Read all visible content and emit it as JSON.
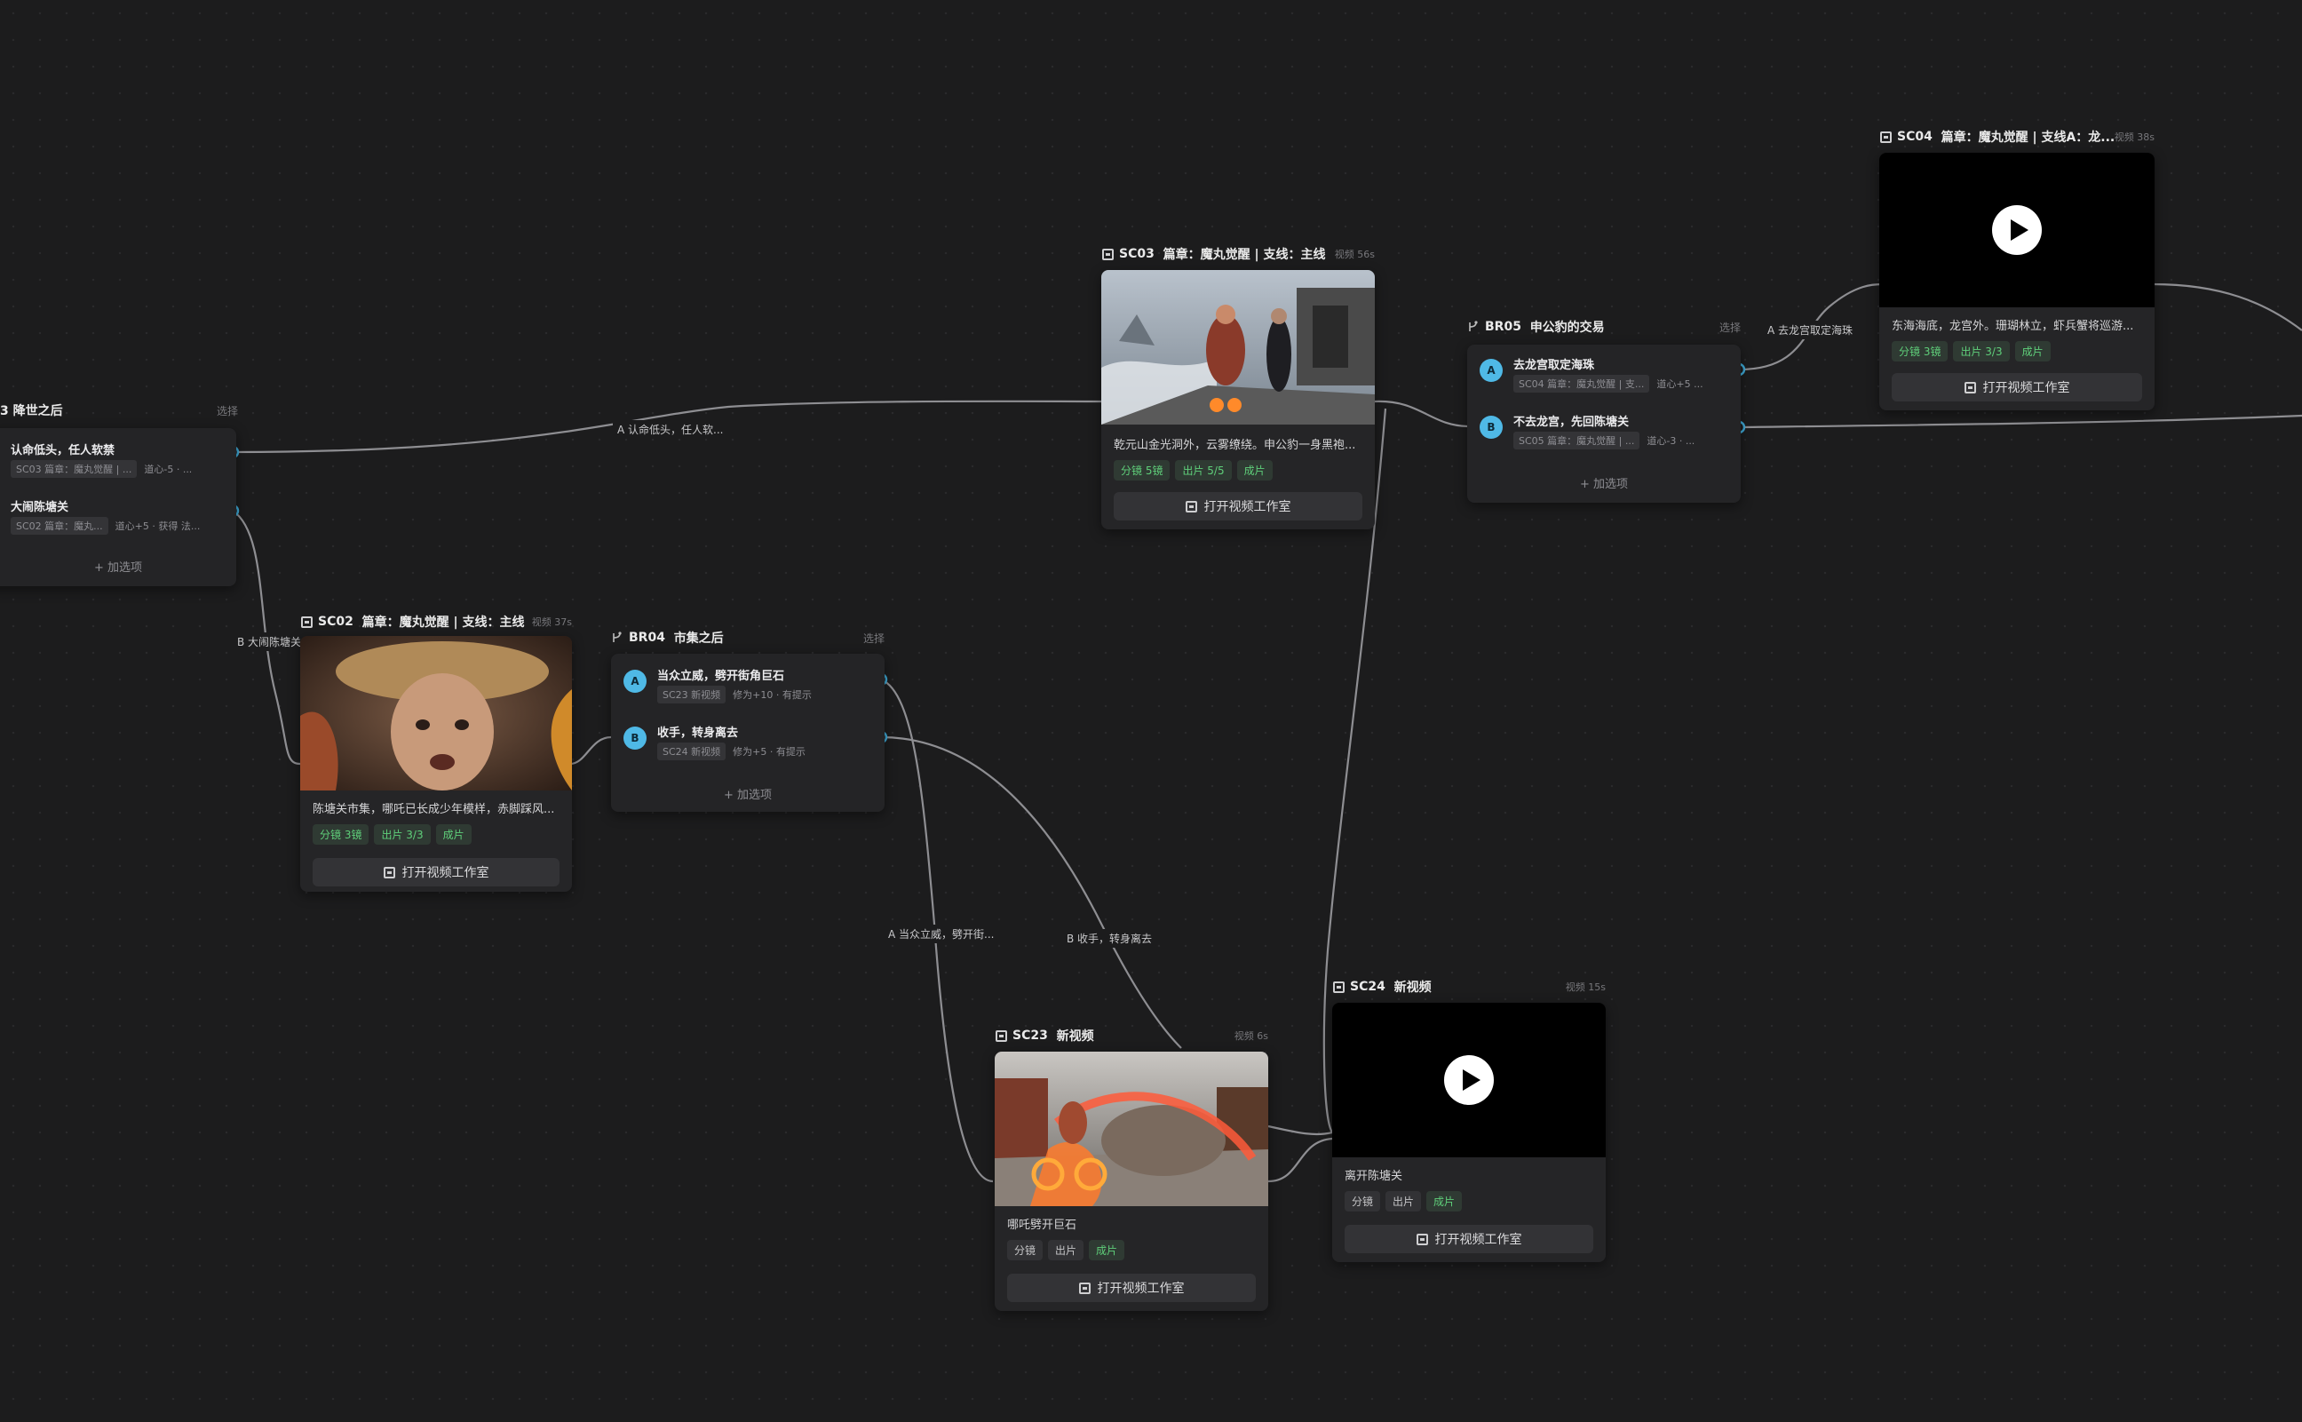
{
  "edge_labels": {
    "a_rengming": "A 认命低头，任人软...",
    "b_danao": "B 大闹陈塘关",
    "a_dangzhong": "A 当众立威，劈开街...",
    "b_shoushou": "B 收手，转身离去",
    "a_qu_longgong": "A 去龙宫取定海珠"
  },
  "br03": {
    "title": "3  降世之后",
    "select": "选择",
    "options": [
      {
        "title": "认命低头，任人软禁",
        "chip": "SC03 篇章：魔丸觉醒 | ...",
        "effect": "道心-5 · ..."
      },
      {
        "title": "大闹陈塘关",
        "chip": "SC02 篇章：魔丸...",
        "effect": "道心+5 · 获得 法..."
      }
    ],
    "add": "+ 加选项"
  },
  "br04": {
    "id": "BR04",
    "title": "市集之后",
    "select": "选择",
    "options": [
      {
        "letter": "A",
        "title": "当众立威，劈开街角巨石",
        "chip": "SC23 新视频",
        "effect": "修为+10 · 有提示"
      },
      {
        "letter": "B",
        "title": "收手，转身离去",
        "chip": "SC24 新视频",
        "effect": "修为+5 · 有提示"
      }
    ],
    "add": "+ 加选项"
  },
  "br05": {
    "id": "BR05",
    "title": "申公豹的交易",
    "select": "选择",
    "options": [
      {
        "letter": "A",
        "title": "去龙宫取定海珠",
        "chip": "SC04 篇章：魔丸觉醒 | 支...",
        "effect": "道心+5 ..."
      },
      {
        "letter": "B",
        "title": "不去龙宫，先回陈塘关",
        "chip": "SC05 篇章：魔丸觉醒 | ...",
        "effect": "道心-3 · ..."
      }
    ],
    "add": "+ 加选项"
  },
  "sc02": {
    "id": "SC02",
    "title": "篇章：魔丸觉醒 | 支线：主线",
    "meta": "视频 37s",
    "desc": "陈塘关市集，哪吒已长成少年模样，赤脚踩风...",
    "tags": [
      "分镜  3镜",
      "出片  3/3",
      "成片"
    ],
    "button": "打开视频工作室"
  },
  "sc03": {
    "id": "SC03",
    "title": "篇章：魔丸觉醒 | 支线：主线",
    "meta": "视频 56s",
    "desc": "乾元山金光洞外，云雾缭绕。申公豹一身黑袍...",
    "tags": [
      "分镜  5镜",
      "出片  5/5",
      "成片"
    ],
    "button": "打开视频工作室"
  },
  "sc04": {
    "id": "SC04",
    "title": "篇章：魔丸觉醒 | 支线A：龙...",
    "meta": "视频 38s",
    "desc": "东海海底，龙宫外。珊瑚林立，虾兵蟹将巡游...",
    "tags": [
      "分镜  3镜",
      "出片  3/3",
      "成片"
    ],
    "button": "打开视频工作室"
  },
  "sc23": {
    "id": "SC23",
    "title": "新视频",
    "meta": "视频 6s",
    "desc": "哪吒劈开巨石",
    "tags": [
      "分镜",
      "出片",
      "成片"
    ],
    "button": "打开视频工作室"
  },
  "sc24": {
    "id": "SC24",
    "title": "新视频",
    "meta": "视频 15s",
    "desc": "离开陈塘关",
    "tags": [
      "分镜",
      "出片",
      "成片"
    ],
    "button": "打开视频工作室"
  },
  "colors": {
    "port": "#3fa9d6",
    "badge": "#4fb9e6",
    "tag_green": "#5fcf7a",
    "canvas": "#1c1c1d"
  }
}
